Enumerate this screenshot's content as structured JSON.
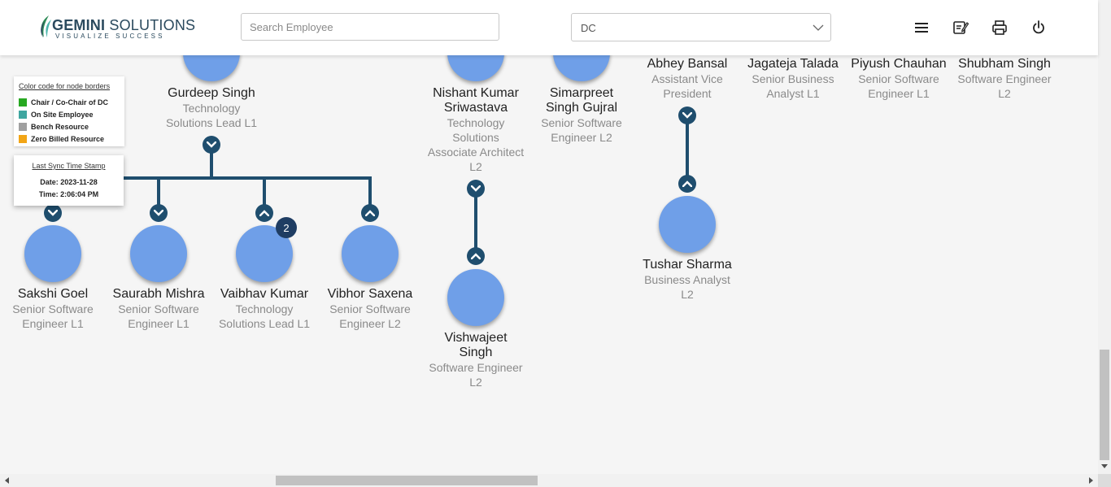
{
  "header": {
    "logo_main_bold": "GEMINI",
    "logo_main_light": " SOLUTIONS",
    "logo_tagline": "VISUALIZE SUCCESS",
    "search_placeholder": "Search Employee",
    "dc_select_value": "DC",
    "icons": [
      "menu-icon",
      "notes-icon",
      "printer-icon",
      "power-icon"
    ]
  },
  "legend": {
    "title": "Color code for node borders",
    "items": [
      {
        "label": "Chair / Co-Chair of DC",
        "color": "#27a821"
      },
      {
        "label": "On Site Employee",
        "color": "#3fa6a0"
      },
      {
        "label": "Bench Resource",
        "color": "#a0a0a0"
      },
      {
        "label": "Zero Billed Resource",
        "color": "#f2a516"
      }
    ]
  },
  "sync": {
    "title": "Last Sync Time Stamp",
    "date": "Date: 2023-11-28",
    "time": "Time: 2:06:04 PM"
  },
  "nodes": {
    "gurdeep": {
      "name": "Gurdeep Singh",
      "role_lines": [
        "Technology",
        "Solutions Lead L1"
      ]
    },
    "nishant": {
      "name_lines": [
        "Nishant Kumar",
        "Sriwastava"
      ],
      "role_lines": [
        "Technology",
        "Solutions",
        "Associate Architect",
        "L2"
      ]
    },
    "simarpreet": {
      "name_lines": [
        "Simarpreet",
        "Singh Gujral"
      ],
      "role_lines": [
        "Senior Software",
        "Engineer L2"
      ]
    },
    "abhey": {
      "name": "Abhey Bansal",
      "role_lines": [
        "Assistant Vice",
        "President"
      ]
    },
    "jagateja": {
      "name": "Jagateja Talada",
      "role_lines": [
        "Senior Business",
        "Analyst L1"
      ]
    },
    "piyush": {
      "name": "Piyush Chauhan",
      "role_lines": [
        "Senior Software",
        "Engineer L1"
      ]
    },
    "shubham": {
      "name": "Shubham Singh",
      "role_lines": [
        "Software Engineer",
        "L2"
      ]
    },
    "sakshi": {
      "name": "Sakshi Goel",
      "role_lines": [
        "Senior Software",
        "Engineer L1"
      ]
    },
    "saurabh": {
      "name": "Saurabh Mishra",
      "role_lines": [
        "Senior Software",
        "Engineer L1"
      ]
    },
    "vaibhav": {
      "name": "Vaibhav Kumar",
      "role_lines": [
        "Technology",
        "Solutions Lead L1"
      ],
      "badge": "2"
    },
    "vibhor": {
      "name": "Vibhor Saxena",
      "role_lines": [
        "Senior Software",
        "Engineer L2"
      ]
    },
    "vishwajeet": {
      "name_lines": [
        "Vishwajeet",
        "Singh"
      ],
      "role_lines": [
        "Software Engineer",
        "L2"
      ]
    },
    "tushar": {
      "name": "Tushar Sharma",
      "role_lines": [
        "Business Analyst",
        "L2"
      ]
    }
  },
  "colors": {
    "node_fill": "#6f9fe8",
    "connector": "#1f4e6e",
    "badge": "#1f3d63"
  }
}
